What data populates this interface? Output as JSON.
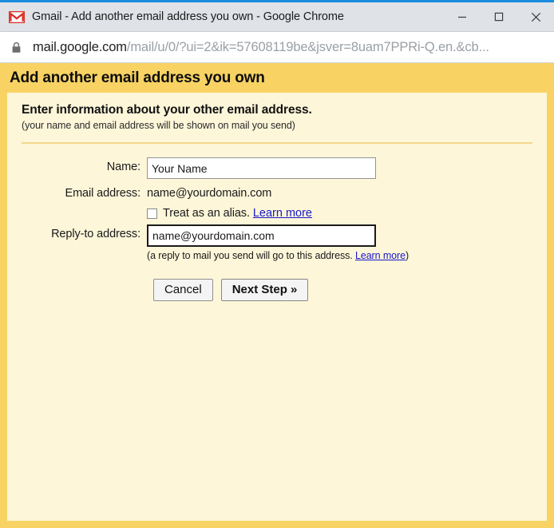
{
  "window": {
    "title": "Gmail - Add another email address you own - Google Chrome",
    "logo_icon": "gmail-m-icon",
    "minimize_label": "—",
    "maximize_label": "□",
    "close_label": "✕",
    "accent_color": "#1a8ce0",
    "titlebar_color": "#dfe3e8"
  },
  "address_bar": {
    "lock_icon": "padlock-icon",
    "url_host": "mail.google.com",
    "url_path": "/mail/u/0/?ui=2&ik=57608119be&jsver=8uam7PPRi-Q.en.&cb...",
    "url_full": "mail.google.com/mail/u/0/?ui=2&ik=57608119be&jsver=8uam7PPRi-Q.en.&cb..."
  },
  "page": {
    "header_title": "Add another email address you own",
    "header_color": "#f8d363",
    "body_color": "#fdf6d9",
    "intro_title": "Enter information about your other email address.",
    "intro_sub": "(your name and email address will be shown on mail you send)",
    "link_color": "#1818cc"
  },
  "form": {
    "name": {
      "label": "Name:",
      "value": "Your Name",
      "placeholder": "Your Name"
    },
    "email_address": {
      "label": "Email address:",
      "value": "name@yourdomain.com"
    },
    "alias": {
      "checked": false,
      "text": "Treat as an alias.",
      "link_label": "Learn more"
    },
    "reply_to": {
      "label": "Reply-to address:",
      "value": "name@yourdomain.com",
      "placeholder": "name@yourdomain.com",
      "hint_prefix": "(a reply to mail you send will go to this address. ",
      "hint_link": "Learn more",
      "hint_suffix": ")"
    }
  },
  "buttons": {
    "cancel_label": "Cancel",
    "next_label": "Next Step »"
  }
}
